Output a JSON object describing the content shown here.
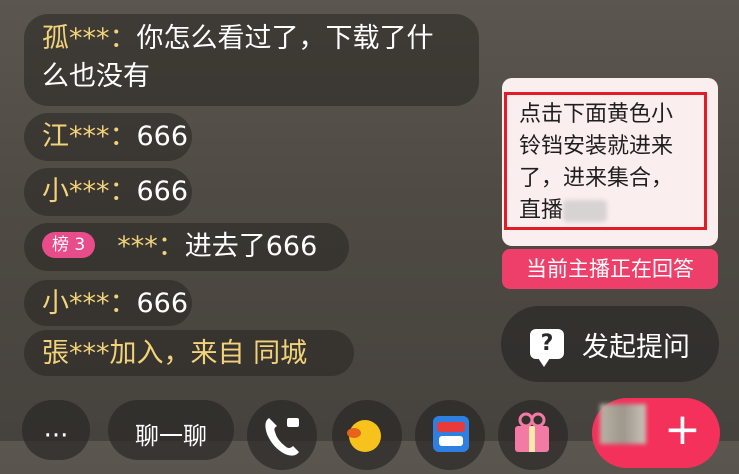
{
  "chat": {
    "messages": [
      {
        "name": "孤***：",
        "text": "你怎么看过了，下载了什",
        "text2": "么也没有"
      },
      {
        "name": "江***：",
        "text": "666"
      },
      {
        "name": "小***：",
        "text": "666"
      },
      {
        "badge": "榜 3",
        "name": "***：",
        "text": "进去了666"
      },
      {
        "name": "小***：",
        "text": "666"
      },
      {
        "name": "張***加入，来自",
        "text": " 同城"
      }
    ]
  },
  "notice": {
    "text": "点击下面黄色小铃铛安装就进来了，进来集合，直播"
  },
  "answering": {
    "label": "当前主播正在回答"
  },
  "ask": {
    "label": "发起提问",
    "icon_glyph": "?"
  },
  "bottom": {
    "more_label": "···",
    "chat_label": "聊一聊",
    "plus_label": "+"
  },
  "colors": {
    "name": "#f2d27a",
    "accent": "#ee3f6a",
    "highlight_border": "#e11c24"
  }
}
